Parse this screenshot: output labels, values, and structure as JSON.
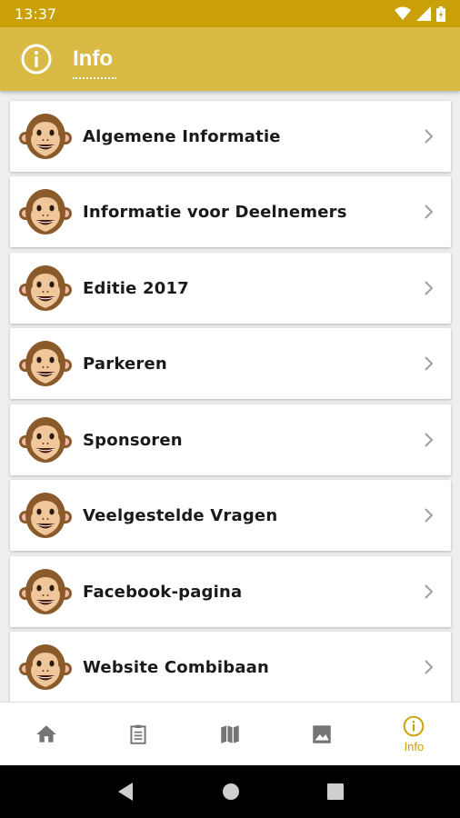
{
  "status": {
    "time": "13:37",
    "icons": [
      "wifi-icon",
      "signal-icon",
      "battery-icon"
    ]
  },
  "app_bar": {
    "title": "Info",
    "icon": "info-icon"
  },
  "items": [
    {
      "label": "Algemene Informatie",
      "icon": "monkey-icon"
    },
    {
      "label": "Informatie voor Deelnemers",
      "icon": "monkey-icon"
    },
    {
      "label": "Editie 2017",
      "icon": "monkey-icon"
    },
    {
      "label": "Parkeren",
      "icon": "monkey-icon"
    },
    {
      "label": "Sponsoren",
      "icon": "monkey-icon"
    },
    {
      "label": "Veelgestelde Vragen",
      "icon": "monkey-icon"
    },
    {
      "label": "Facebook-pagina",
      "icon": "monkey-icon"
    },
    {
      "label": "Website Combibaan",
      "icon": "monkey-icon"
    }
  ],
  "bottom_nav": {
    "items": [
      {
        "icon": "home-icon",
        "label": ""
      },
      {
        "icon": "clipboard-icon",
        "label": ""
      },
      {
        "icon": "map-icon",
        "label": ""
      },
      {
        "icon": "image-icon",
        "label": ""
      },
      {
        "icon": "info-icon",
        "label": "Info",
        "active": true
      }
    ]
  },
  "colors": {
    "status_bar": "#c9a008",
    "app_bar": "#d8ba44",
    "accent": "#c9a008",
    "inactive_icon": "#757575"
  }
}
